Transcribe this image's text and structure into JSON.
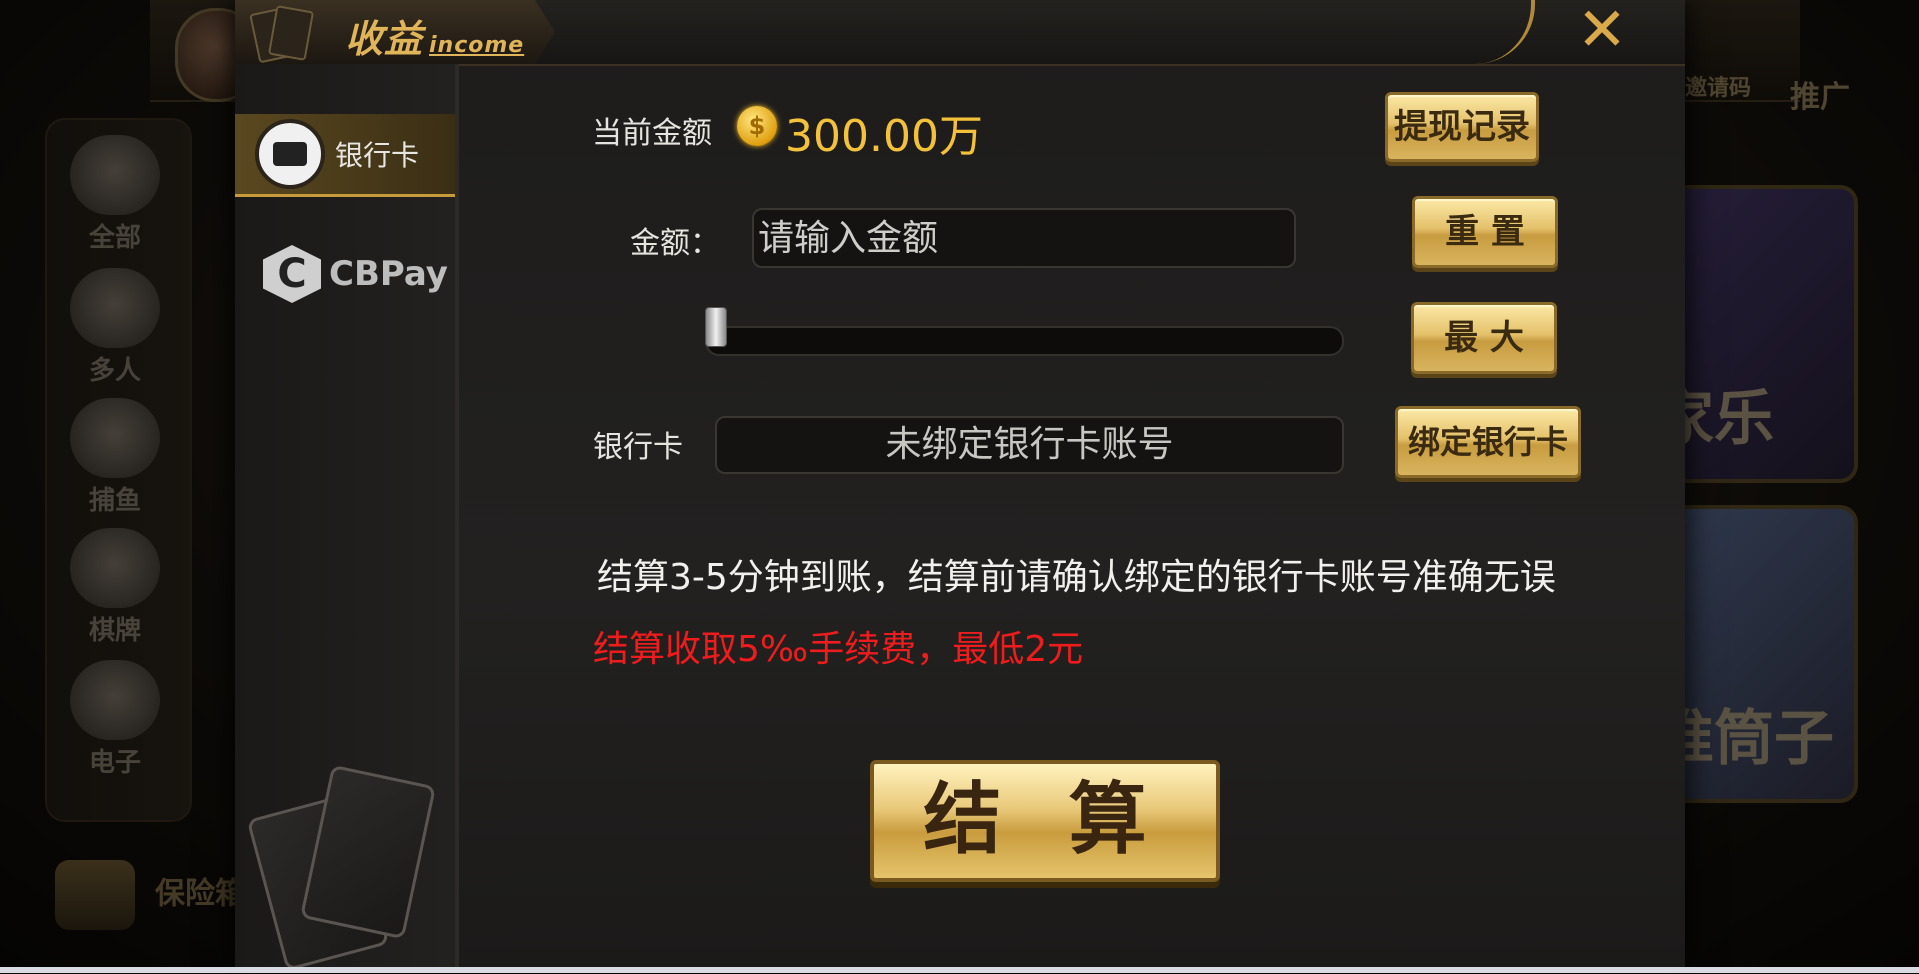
{
  "background": {
    "categories": [
      "全部",
      "多人",
      "捕鱼",
      "棋牌",
      "电子"
    ],
    "right_labels": [
      "邀请码",
      "推广"
    ],
    "card_titles": [
      "家乐",
      "推筒子"
    ],
    "bottom_label": "保险箱"
  },
  "modal": {
    "title": "收益",
    "title_sub": "income",
    "close_icon": "close-icon",
    "tabs": [
      {
        "label": "银行卡",
        "icon": "bank-card-icon",
        "active": true
      },
      {
        "label": "CBPay",
        "icon": "cbpay-logo-icon",
        "active": false
      }
    ],
    "balance": {
      "label": "当前金额",
      "value": "300.00万",
      "icon": "gold-coin-icon"
    },
    "withdraw_history_button": "提现记录",
    "amount": {
      "label": "金额：",
      "placeholder": "请输入金额",
      "value": ""
    },
    "reset_button": "重 置",
    "max_button": "最 大",
    "slider": {
      "value": 0
    },
    "bank_card": {
      "label": "银行卡",
      "value": "未绑定银行卡账号"
    },
    "bind_button": "绑定银行卡",
    "note": "结算3-5分钟到账，结算前请确认绑定的银行卡账号准确无误",
    "fee_note": "结算收取5‰手续费，最低2元",
    "submit_button": "结 算"
  },
  "colors": {
    "gold": "#f4c23a",
    "fee_red": "#ee1c1c",
    "accent": "#c79a3c"
  }
}
